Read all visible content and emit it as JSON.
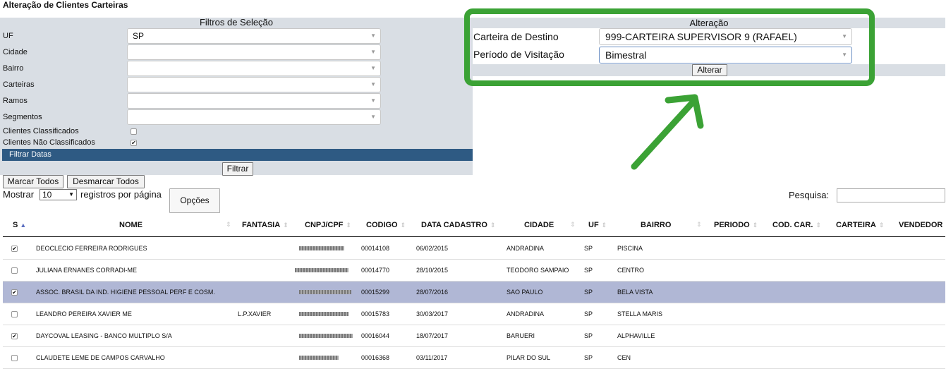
{
  "page_title": "Alteração de Clientes Carteiras",
  "filters": {
    "header": "Filtros de Seleção",
    "fields": [
      {
        "label": "UF",
        "value": "SP"
      },
      {
        "label": "Cidade",
        "value": ""
      },
      {
        "label": "Bairro",
        "value": ""
      },
      {
        "label": "Carteiras",
        "value": ""
      },
      {
        "label": "Ramos",
        "value": ""
      },
      {
        "label": "Segmentos",
        "value": ""
      }
    ],
    "checks": [
      {
        "label": "Clientes Classificados",
        "checked": false
      },
      {
        "label": "Clientes Não Classificados",
        "checked": true
      }
    ],
    "filtrar_datas": "Filtrar Datas",
    "filtrar_button": "Filtrar"
  },
  "alteracao": {
    "header": "Alteração",
    "destino_label": "Carteira de Destino",
    "destino_value": "999-CARTEIRA SUPERVISOR 9 (RAFAEL)",
    "periodo_label": "Período de Visitação",
    "periodo_value": "Bimestral",
    "alterar_button": "Alterar"
  },
  "buttons": {
    "marcar": "Marcar Todos",
    "desmarcar": "Desmarcar Todos",
    "opcoes": "Opções"
  },
  "length": {
    "prefix": "Mostrar",
    "value": "10",
    "suffix": "registros por página"
  },
  "search": {
    "label": "Pesquisa:"
  },
  "columns": [
    "S",
    "NOME",
    "FANTASIA",
    "CNPJ/CPF",
    "CODIGO",
    "DATA CADASTRO",
    "CIDADE",
    "UF",
    "BAIRRO",
    "PERIODO",
    "COD. CAR.",
    "CARTEIRA",
    "VENDEDOR"
  ],
  "rows": [
    {
      "checked": true,
      "nome": "DEOCLECIO FERREIRA RODRIGUES",
      "fantasia": "",
      "codigo": "00014108",
      "data": "06/02/2015",
      "cidade": "ANDRADINA",
      "uf": "SP",
      "bairro": "PISCINA",
      "selected": false
    },
    {
      "checked": false,
      "nome": "JULIANA ERNANES CORRADI-ME",
      "fantasia": "",
      "codigo": "00014770",
      "data": "28/10/2015",
      "cidade": "TEODORO SAMPAIO",
      "uf": "SP",
      "bairro": "CENTRO",
      "selected": false
    },
    {
      "checked": true,
      "nome": "ASSOC. BRASIL DA IND. HIGIENE PESSOAL PERF E COSM.",
      "fantasia": "",
      "codigo": "00015299",
      "data": "28/07/2016",
      "cidade": "SAO PAULO",
      "uf": "SP",
      "bairro": "BELA VISTA",
      "selected": true
    },
    {
      "checked": false,
      "nome": "LEANDRO PEREIRA XAVIER ME",
      "fantasia": "L.P.XAVIER",
      "codigo": "00015783",
      "data": "30/03/2017",
      "cidade": "ANDRADINA",
      "uf": "SP",
      "bairro": "STELLA MARIS",
      "selected": false
    },
    {
      "checked": true,
      "nome": "DAYCOVAL LEASING - BANCO MULTIPLO S/A",
      "fantasia": "",
      "codigo": "00016044",
      "data": "18/07/2017",
      "cidade": "BARUERI",
      "uf": "SP",
      "bairro": "ALPHAVILLE",
      "selected": false
    },
    {
      "checked": false,
      "nome": "CLAUDETE LEME DE CAMPOS CARVALHO",
      "fantasia": "",
      "codigo": "00016368",
      "data": "03/11/2017",
      "cidade": "PILAR DO SUL",
      "uf": "SP",
      "bairro": "CEN",
      "selected": false
    }
  ]
}
